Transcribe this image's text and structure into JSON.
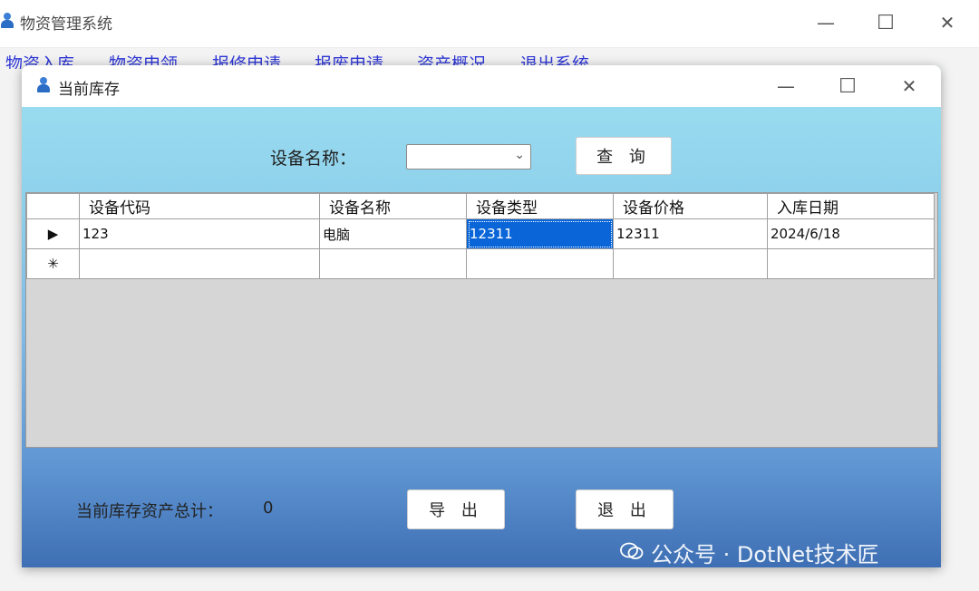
{
  "main_window": {
    "title": "物资管理系统",
    "controls": {
      "minimize": "—",
      "maximize": "☐",
      "close": "✕"
    },
    "menu": [
      "物资入库",
      "物资申领",
      "报修申请",
      "报废申请",
      "资产概况",
      "退出系统"
    ]
  },
  "dialog": {
    "title": "当前库存",
    "controls": {
      "minimize": "—",
      "maximize": "☐",
      "close": "✕"
    },
    "search": {
      "label": "设备名称：",
      "value": "",
      "button": "查 询"
    },
    "grid": {
      "columns": [
        "设备代码",
        "设备名称",
        "设备类型",
        "设备价格",
        "入库日期"
      ],
      "rows": [
        {
          "indicator": "▶",
          "cells": [
            "123",
            "电脑",
            "12311",
            "12311",
            "2024/6/18"
          ]
        },
        {
          "indicator": "✳",
          "cells": [
            "",
            "",
            "",
            "",
            ""
          ]
        }
      ],
      "selected_cell": "设备类型"
    },
    "total": {
      "label": "当前库存资产总计：",
      "value": "0"
    },
    "buttons": {
      "export": "导 出",
      "exit": "退 出"
    }
  },
  "watermark": "公众号 · DotNet技术匠",
  "colors": {
    "selection": "#0a66d8",
    "menu_text": "#2f38d6"
  }
}
